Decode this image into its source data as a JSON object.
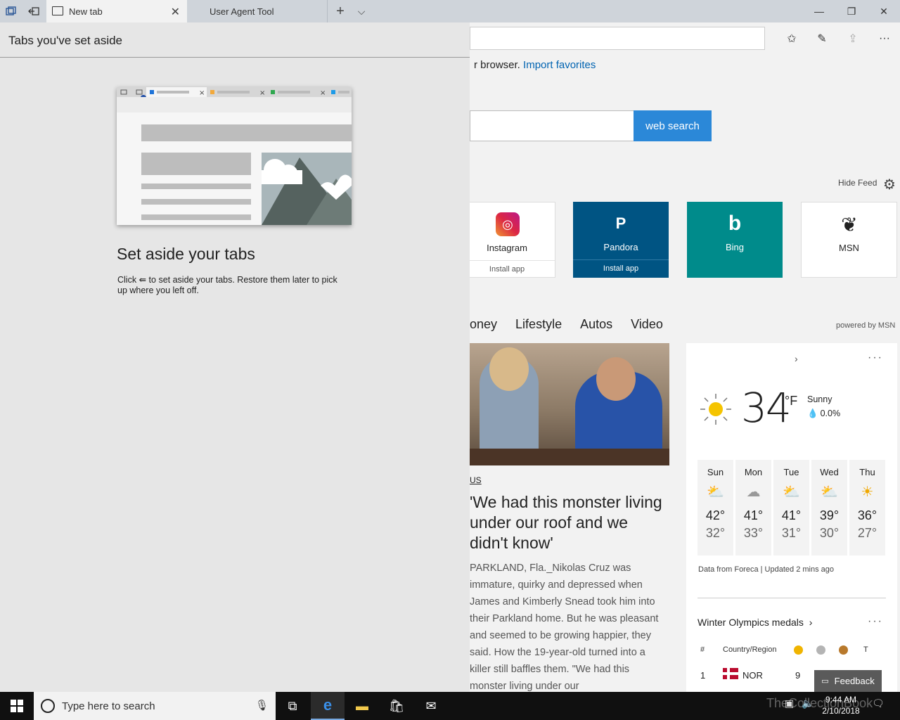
{
  "tabs": {
    "active_title": "New tab",
    "inactive_title": "User Agent Tool"
  },
  "window": {
    "minimize": "—",
    "restore": "❐",
    "close": "✕"
  },
  "newtab_page": {
    "import_text": "r browser.",
    "import_link": "Import favorites",
    "search_button": "web search",
    "hide_feed": "Hide Feed",
    "tiles": [
      {
        "name": "Instagram",
        "sub": "Install app"
      },
      {
        "name": "Pandora",
        "sub": "Install app",
        "icon": "P"
      },
      {
        "name": "Bing"
      },
      {
        "name": "MSN"
      }
    ],
    "nav": [
      "oney",
      "Lifestyle",
      "Autos",
      "Video"
    ],
    "powered_by": "powered by MSN",
    "story": {
      "category": "US",
      "title": "'We had this monster living under our roof and we didn't know'",
      "body": "PARKLAND, Fla._Nikolas Cruz was immature, quirky and depressed when James and Kimberly Snead took him into their Parkland home. But he was pleasant and seemed to be growing happier, they said. How the 19-year-old turned into a killer still baffles them. \"We had this monster living under our"
    },
    "weather": {
      "temp": "34",
      "unit": "°F",
      "condition": "Sunny",
      "precip": "0.0%",
      "forecast": [
        {
          "day": "Sun",
          "hi": "42°",
          "lo": "32°",
          "icon": "partly-cloudy-icon"
        },
        {
          "day": "Mon",
          "hi": "41°",
          "lo": "33°",
          "icon": "cloudy-icon"
        },
        {
          "day": "Tue",
          "hi": "41°",
          "lo": "31°",
          "icon": "partly-cloudy-icon"
        },
        {
          "day": "Wed",
          "hi": "39°",
          "lo": "30°",
          "icon": "partly-cloudy-icon"
        },
        {
          "day": "Thu",
          "hi": "36°",
          "lo": "27°",
          "icon": "sunny-icon"
        }
      ],
      "source": "Data from Foreca | Updated 2 mins ago"
    },
    "olympics": {
      "title": "Winter Olympics medals",
      "head_rank": "#",
      "head_country": "Country/Region",
      "head_total": "T",
      "row_rank": "1",
      "row_country": "NOR",
      "row_gold": "9",
      "medal_colors": [
        "#f0b400",
        "#b4b4b4",
        "#b8792c"
      ]
    },
    "feedback": "Feedback"
  },
  "set_aside": {
    "title": "Tabs you've set aside",
    "heading": "Set aside your tabs",
    "desc_before": "Click",
    "desc_after": "to set aside your tabs. Restore them later to pick up where you left off."
  },
  "taskbar": {
    "search_placeholder": "Type here to search",
    "time": "9:44 AM",
    "date": "2/10/2018",
    "watermark": "TheCollectionBook"
  },
  "colors": {
    "accent": "#2b88d8",
    "link": "#0063b1",
    "pandora": "#005483",
    "bing": "#008b8b"
  }
}
